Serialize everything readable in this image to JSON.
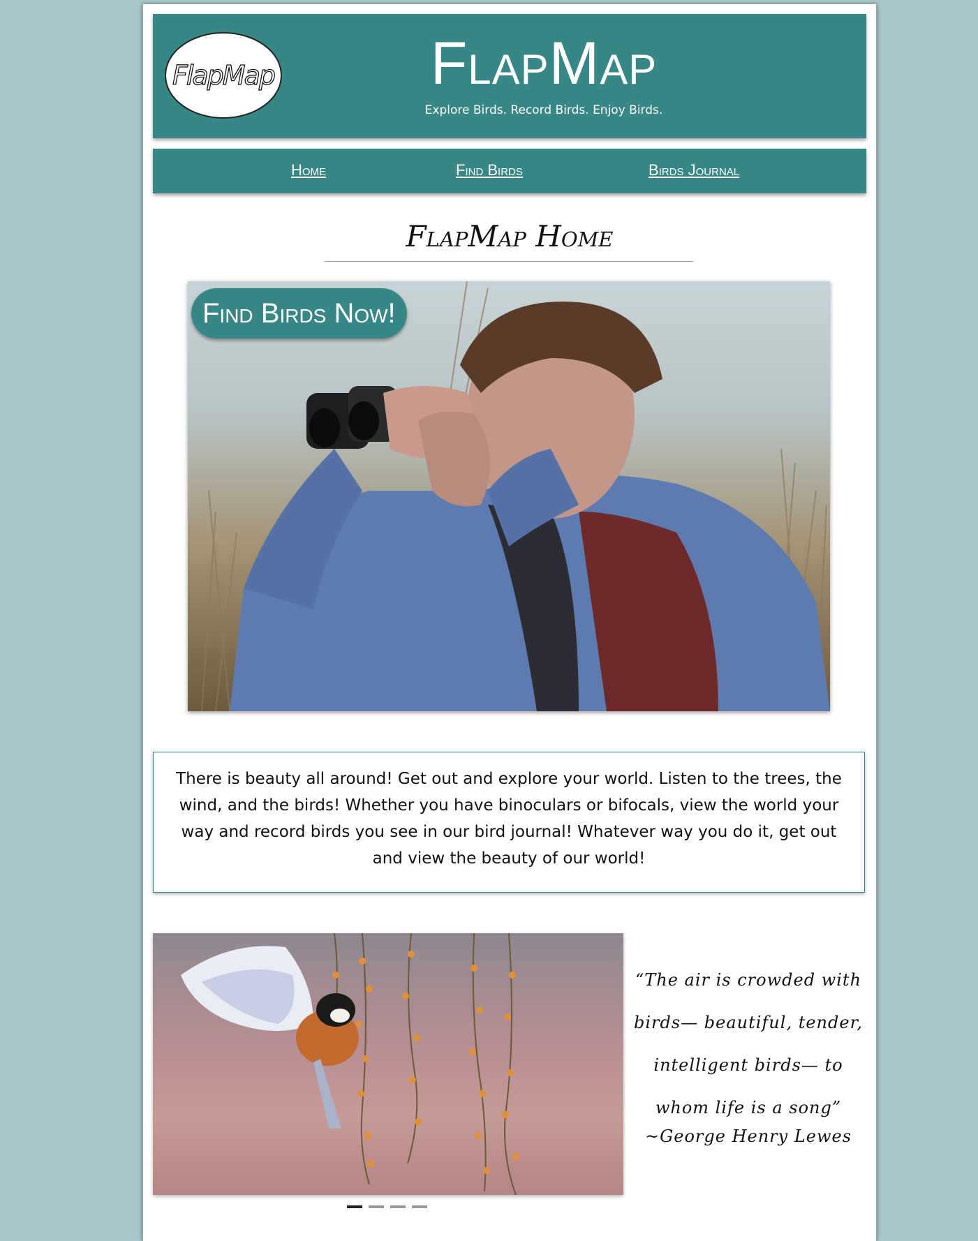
{
  "header": {
    "logo_text": "FlapMap",
    "site_title": "FlapMap",
    "tagline": "Explore Birds. Record Birds. Enjoy Birds."
  },
  "nav": {
    "items": [
      {
        "label": "Home"
      },
      {
        "label": "Find Birds"
      },
      {
        "label": "Birds Journal"
      }
    ]
  },
  "main": {
    "page_title": "FlapMap Home",
    "cta_label": "Find Birds Now!",
    "intro_text": "There is beauty all around! Get out and explore your world. Listen to the trees, the wind, and the birds! Whether you have binoculars or bifocals, view the world your way and record birds you see in our bird journal! Whatever way you do it, get out and view the beauty of our world!",
    "quote": "“The air is crowded with birds— beautiful, tender, intelligent birds— to whom life is a song”",
    "attribution": "~George Henry Lewes",
    "carousel": {
      "slide_count": 4,
      "active_index": 0
    }
  },
  "colors": {
    "brand_teal": "#368785",
    "page_background": "#a9c7c9"
  }
}
